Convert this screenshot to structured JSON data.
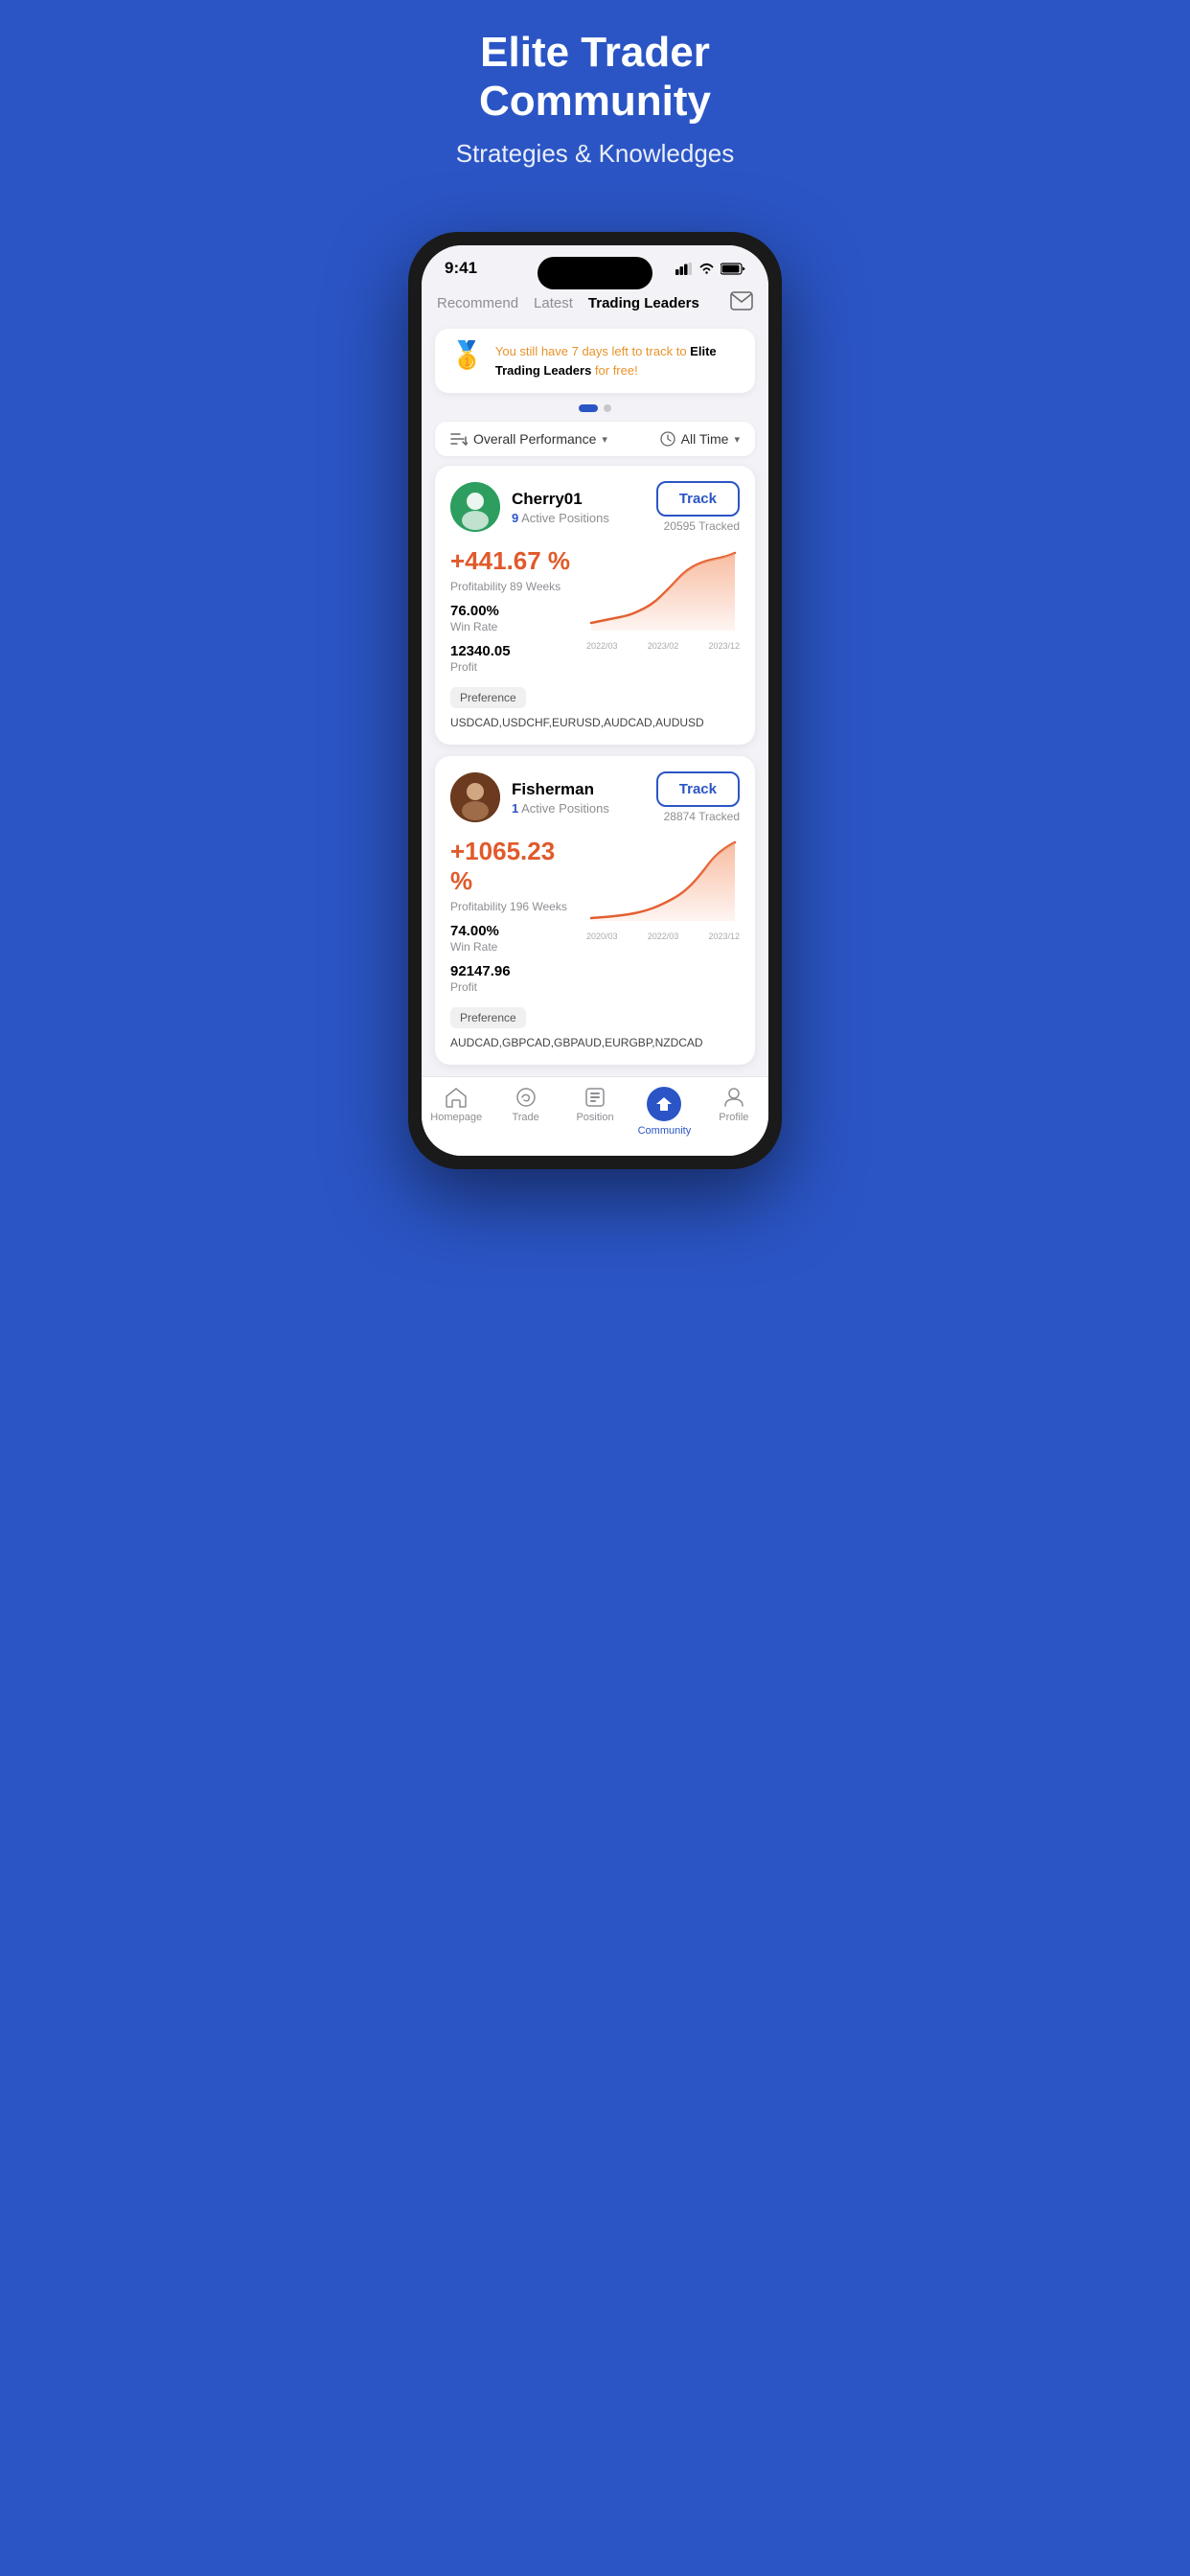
{
  "hero": {
    "title": "Elite Trader\nCommunity",
    "subtitle": "Strategies & Knowledges"
  },
  "status_bar": {
    "time": "9:41",
    "signal": "▂▄▆",
    "wifi": "wifi",
    "battery": "battery"
  },
  "nav_tabs": [
    {
      "label": "Recommend",
      "active": false
    },
    {
      "label": "Latest",
      "active": false
    },
    {
      "label": "Trading Leaders",
      "active": true
    }
  ],
  "mail_icon": "✉",
  "banner": {
    "icon": "🥇",
    "text_orange": "You still have 7 days left to track to",
    "text_bold": " Elite Trading Leaders",
    "text_end": " for free!"
  },
  "filter": {
    "performance_label": "Overall Performance",
    "time_label": "All Time"
  },
  "traders": [
    {
      "id": "cherry01",
      "name": "Cherry01",
      "active_positions": 9,
      "track_label": "Track",
      "tracked_count": "20595 Tracked",
      "profit_pct": "+441.67 %",
      "profitability_label": "Profitability",
      "weeks": "89 Weeks",
      "win_rate_value": "76.00%",
      "win_rate_label": "Win Rate",
      "profit_value": "12340.05",
      "profit_label": "Profit",
      "chart_dates": [
        "2022/03",
        "2023/02",
        "2023/12"
      ],
      "pref_label": "Preference",
      "preferences": "USDCAD,USDCHF,EURUSD,AUDCAD,AUDUSD"
    },
    {
      "id": "fisherman",
      "name": "Fisherman",
      "active_positions": 1,
      "track_label": "Track",
      "tracked_count": "28874 Tracked",
      "profit_pct": "+1065.23 %",
      "profitability_label": "Profitability",
      "weeks": "196 Weeks",
      "win_rate_value": "74.00%",
      "win_rate_label": "Win Rate",
      "profit_value": "92147.96",
      "profit_label": "Profit",
      "chart_dates": [
        "2020/03",
        "2022/03",
        "2023/12"
      ],
      "pref_label": "Preference",
      "preferences": "AUDCAD,GBPCAD,GBPAUD,EURGBP,NZDCAD"
    }
  ],
  "bottom_nav": [
    {
      "label": "Homepage",
      "icon": "home",
      "active": false
    },
    {
      "label": "Trade",
      "icon": "trade",
      "active": false
    },
    {
      "label": "Position",
      "icon": "position",
      "active": false
    },
    {
      "label": "Community",
      "icon": "community",
      "active": true
    },
    {
      "label": "Profile",
      "icon": "profile",
      "active": false
    }
  ]
}
